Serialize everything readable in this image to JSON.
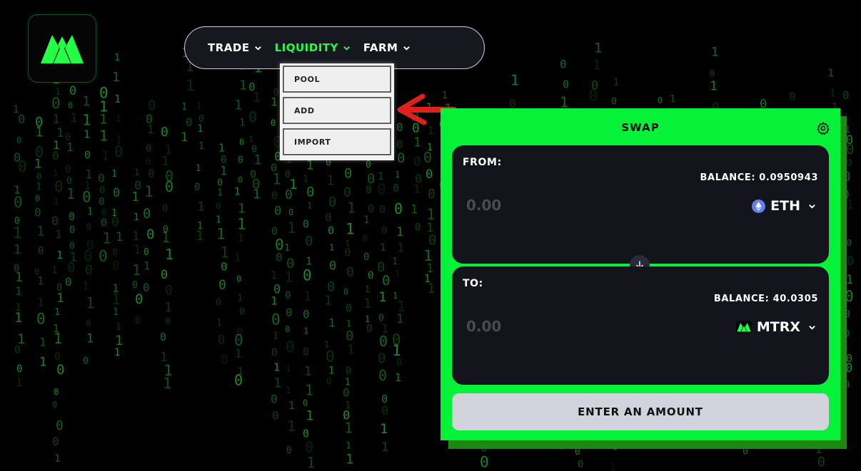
{
  "nav": {
    "trade_label": "TRADE",
    "liquidity_label": "LIQUIDITY",
    "farm_label": "FARM"
  },
  "liquidity_menu": {
    "items": [
      "POOL",
      "ADD",
      "IMPORT"
    ]
  },
  "swap": {
    "title": "SWAP",
    "from": {
      "label": "FROM:",
      "balance": "BALANCE: 0.0950943",
      "amount_placeholder": "0.00",
      "token": "ETH",
      "token_icon": "ethereum-icon"
    },
    "to": {
      "label": "TO:",
      "balance": "BALANCE: 40.0305",
      "amount_placeholder": "0.00",
      "token": "MTRX",
      "token_icon": "mtrx-logo-icon"
    },
    "submit_label": "ENTER AN AMOUNT"
  },
  "colors": {
    "accent": "#05f238",
    "accent_shadow": "#1a8a12",
    "nav_active": "#1dff4a",
    "panel_box": "#14141c",
    "button_disabled": "#d3d3de",
    "annotation_arrow": "#e0201f"
  }
}
